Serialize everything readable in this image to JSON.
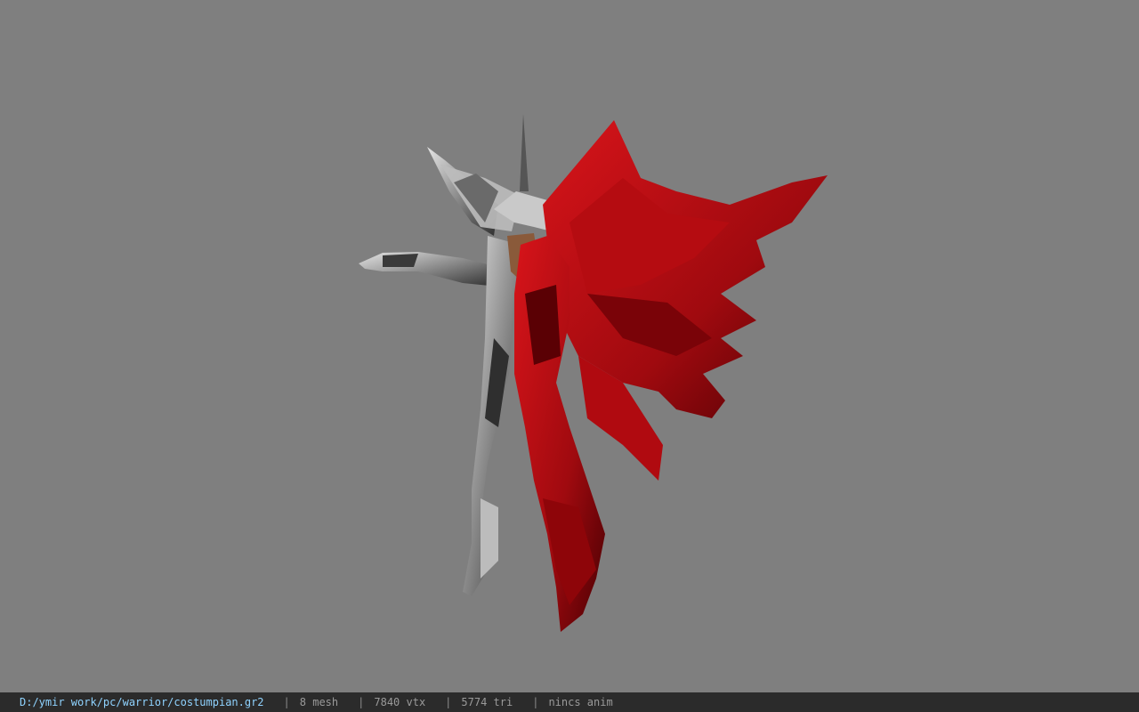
{
  "viewport": {
    "background_color": "#7f7f7f",
    "model_colors": {
      "silver_light": "#d9d9d9",
      "silver_dark": "#3a3a3a",
      "red_bright": "#c80f14",
      "red_dark": "#5a0004",
      "skin": "#8a5a3a"
    }
  },
  "status_bar": {
    "file_path": "D:/ymir work/pc/warrior/costumpian.gr2",
    "separator": "|",
    "mesh_count": "8 mesh",
    "vertex_count": "7840 vtx",
    "triangle_count": "5774 tri",
    "animation": "nincs anim",
    "path_color": "#8fd3ff",
    "bar_color": "#2b2b2b"
  }
}
